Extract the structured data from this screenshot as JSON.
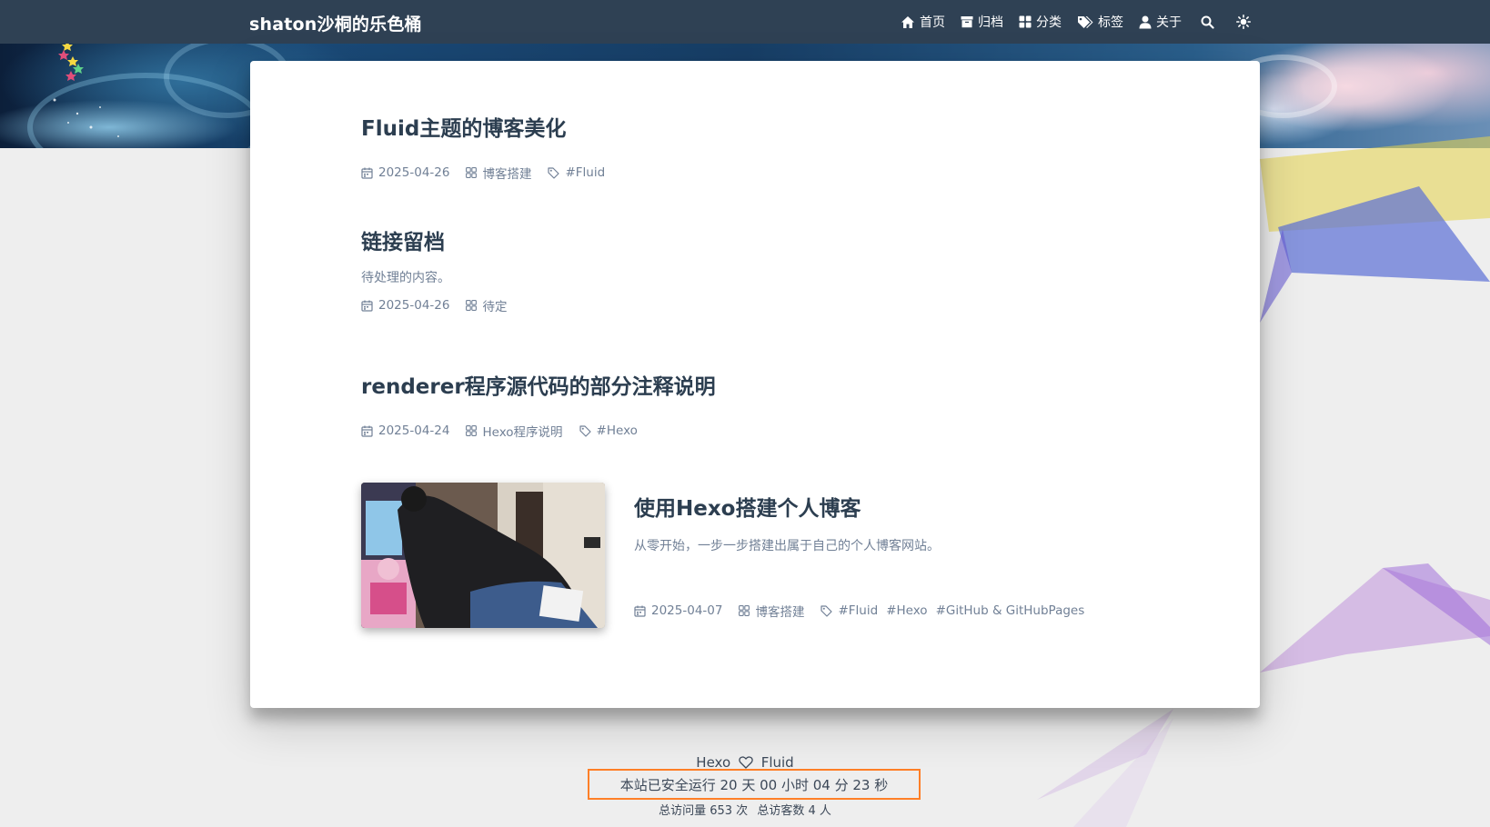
{
  "navbar": {
    "brand": "shaton沙桐的乐色桶",
    "items": [
      {
        "label": "首页",
        "icon": "home-icon"
      },
      {
        "label": "归档",
        "icon": "archive-icon"
      },
      {
        "label": "分类",
        "icon": "category-icon"
      },
      {
        "label": "标签",
        "icon": "tags-icon"
      },
      {
        "label": "关于",
        "icon": "user-icon"
      }
    ],
    "search_icon": "search-icon",
    "theme_icon": "sun-icon"
  },
  "posts": [
    {
      "title": "Fluid主题的博客美化",
      "date": "2025-04-26",
      "category": "博客搭建",
      "tags": [
        "#Fluid"
      ]
    },
    {
      "title": "链接留档",
      "excerpt": "待处理的内容。",
      "date": "2025-04-26",
      "category": "待定"
    },
    {
      "title": "renderer程序源代码的部分注释说明",
      "date": "2025-04-24",
      "category": "Hexo程序说明",
      "tags": [
        "#Hexo"
      ]
    },
    {
      "title": "使用Hexo搭建个人博客",
      "excerpt": "从零开始，一步一步搭建出属于自己的个人博客网站。",
      "date": "2025-04-07",
      "category": "博客搭建",
      "tags": [
        "#Fluid",
        "#Hexo",
        "#GitHub & GitHubPages"
      ]
    }
  ],
  "footer": {
    "powered_left": "Hexo",
    "powered_right": "Fluid",
    "runtime": "本站已安全运行 20 天 00 小时 04 分 23 秒",
    "pv": "总访问量 653 次",
    "uv": "总访客数 4 人"
  },
  "colors": {
    "navbar_bg": "#2f4154",
    "highlight_border": "#ff7f27",
    "body_bg": "#eeeeee"
  }
}
